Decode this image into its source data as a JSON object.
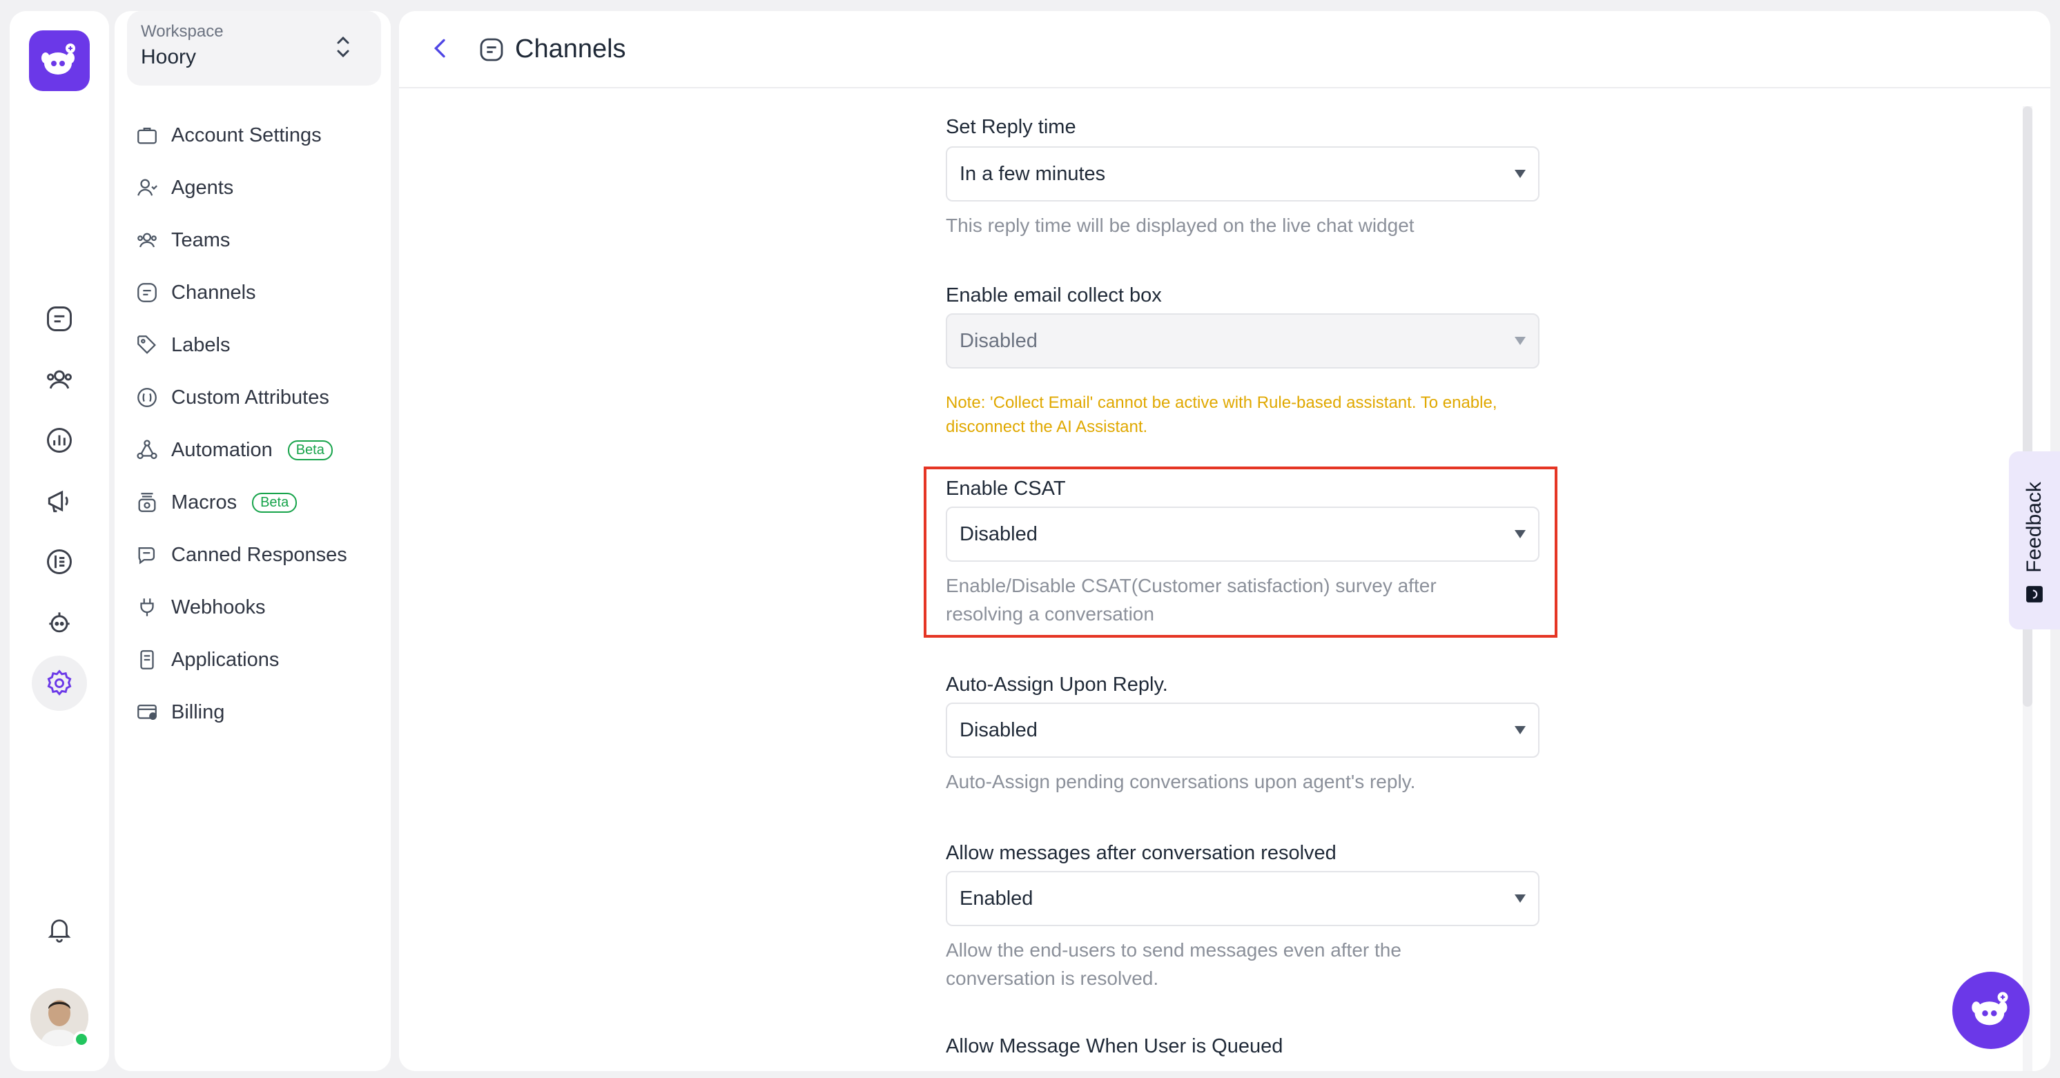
{
  "workspace": {
    "label": "Workspace",
    "name": "Hoory"
  },
  "settings_nav": [
    {
      "label": "Account Settings",
      "icon": "briefcase-icon"
    },
    {
      "label": "Agents",
      "icon": "user-icon"
    },
    {
      "label": "Teams",
      "icon": "users-icon"
    },
    {
      "label": "Channels",
      "icon": "channel-icon"
    },
    {
      "label": "Labels",
      "icon": "tag-icon"
    },
    {
      "label": "Custom Attributes",
      "icon": "attribute-icon"
    },
    {
      "label": "Automation",
      "icon": "automation-icon",
      "badge": "Beta"
    },
    {
      "label": "Macros",
      "icon": "macro-icon",
      "badge": "Beta"
    },
    {
      "label": "Canned Responses",
      "icon": "chat-reply-icon"
    },
    {
      "label": "Webhooks",
      "icon": "webhook-icon"
    },
    {
      "label": "Applications",
      "icon": "application-icon"
    },
    {
      "label": "Billing",
      "icon": "billing-icon"
    }
  ],
  "rail_icons": [
    "conversations-icon",
    "contacts-icon",
    "reports-icon",
    "campaigns-icon",
    "knowledge-base-icon",
    "bot-icon",
    "settings-icon",
    "bell-icon"
  ],
  "header": {
    "title": "Channels"
  },
  "form": {
    "reply_time": {
      "label": "Set Reply time",
      "value": "In a few minutes",
      "help": "This reply time will be displayed on the live chat widget"
    },
    "email_collect": {
      "label": "Enable email collect box",
      "value": "Disabled",
      "note_line1": "Note: 'Collect Email' cannot be active with Rule-based assistant. To enable,",
      "note_line2": "disconnect the AI Assistant."
    },
    "csat": {
      "label": "Enable CSAT",
      "value": "Disabled",
      "help_line1": "Enable/Disable CSAT(Customer satisfaction) survey after",
      "help_line2": "resolving a conversation"
    },
    "auto_assign": {
      "label": "Auto-Assign Upon Reply.",
      "value": "Disabled",
      "help": "Auto-Assign pending conversations upon agent's reply."
    },
    "allow_after_resolved": {
      "label": "Allow messages after conversation resolved",
      "value": "Enabled",
      "help_line1": "Allow the end-users to send messages even after the",
      "help_line2": "conversation is resolved."
    },
    "queued": {
      "label": "Allow Message When User is Queued"
    }
  },
  "feedback": {
    "label": "Feedback"
  },
  "colors": {
    "brand": "#6b38e8",
    "highlight": "#e53524",
    "note": "#e0a800",
    "beta": "#16a34a"
  }
}
